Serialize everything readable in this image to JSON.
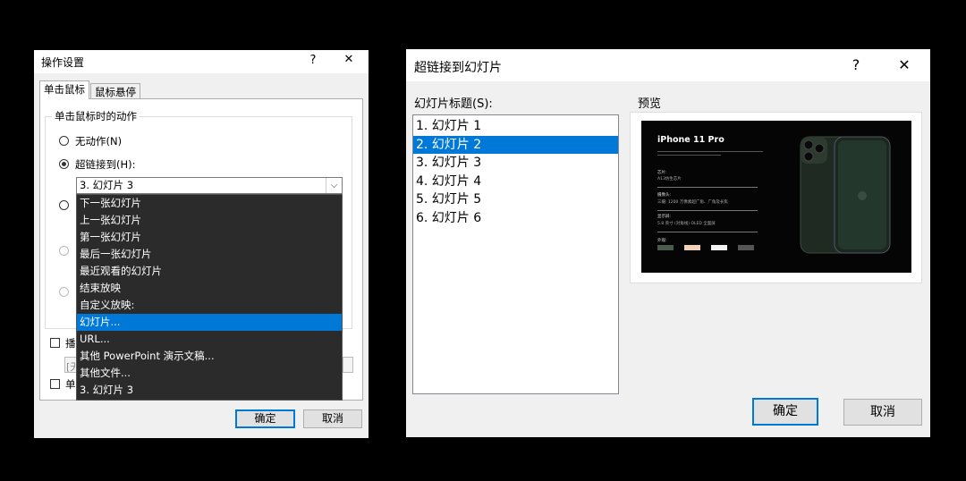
{
  "dialog1": {
    "title": "操作设置",
    "help": "?",
    "close": "✕",
    "tabs": [
      {
        "label": "单击鼠标",
        "active": true
      },
      {
        "label": "鼠标悬停",
        "active": false
      }
    ],
    "group_label": "单击鼠标时的动作",
    "radio_none": "无动作(N)",
    "radio_hyperlink": "超链接到(H):",
    "hyperlink_value": "3. 幻灯片 3",
    "dropdown_items": [
      {
        "label": "下一张幻灯片",
        "selected": false
      },
      {
        "label": "上一张幻灯片",
        "selected": false
      },
      {
        "label": "第一张幻灯片",
        "selected": false
      },
      {
        "label": "最后一张幻灯片",
        "selected": false
      },
      {
        "label": "最近观看的幻灯片",
        "selected": false
      },
      {
        "label": "结束放映",
        "selected": false
      },
      {
        "label": "自定义放映:",
        "selected": false
      },
      {
        "label": "幻灯片...",
        "selected": true
      },
      {
        "label": "URL...",
        "selected": false
      },
      {
        "label": "其他 PowerPoint 演示文稿...",
        "selected": false
      },
      {
        "label": "其他文件...",
        "selected": false
      },
      {
        "label": "3. 幻灯片 3",
        "selected": false
      }
    ],
    "check1_partial": "播",
    "check2_partial": "单",
    "combo2_partial": "[无",
    "ok": "确定",
    "cancel": "取消"
  },
  "dialog2": {
    "title": "超链接到幻灯片",
    "help": "?",
    "close": "✕",
    "list_label": "幻灯片标题(S):",
    "preview_label": "预览",
    "slides": [
      {
        "label": "1. 幻灯片 1",
        "selected": false
      },
      {
        "label": "2. 幻灯片 2",
        "selected": true
      },
      {
        "label": "3. 幻灯片 3",
        "selected": false
      },
      {
        "label": "4. 幻灯片 4",
        "selected": false
      },
      {
        "label": "5. 幻灯片 5",
        "selected": false
      },
      {
        "label": "6. 幻灯片 6",
        "selected": false
      }
    ],
    "preview": {
      "title": "iPhone 11 Pro",
      "chip_label": "芯片:",
      "chip_value": "A13仿生芯片",
      "camera_label": "摄像头:",
      "camera_value": "三摄: 1200 万像素超广角、广角及长焦",
      "screen_label": "显示屏:",
      "screen_value": "5.8 英寸 (对角线) OLED 全面屏",
      "color_label": "外观:"
    },
    "ok": "确定",
    "cancel": "取消"
  },
  "colors": {
    "accent": "#0078d7",
    "dropdown_bg": "#2b2b2b",
    "dialog_bg": "#f0f0f0"
  }
}
